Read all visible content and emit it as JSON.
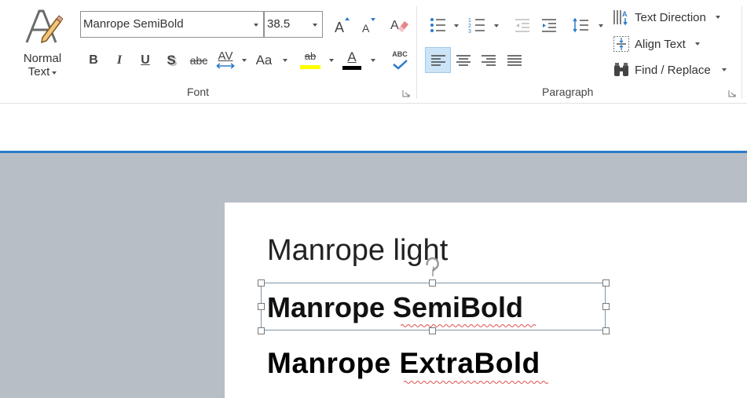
{
  "ribbon": {
    "style": {
      "label_line1": "Normal",
      "label_line2": "Text"
    },
    "font": {
      "family_value": "Manrope SemiBold",
      "size_value": "38.5",
      "group_label": "Font",
      "bold": "B",
      "italic": "I",
      "underline": "U",
      "shadow": "S",
      "strike": "abc",
      "spacing": "AV",
      "case": "Aa",
      "highlight_letters": "ab",
      "font_color_letter": "A",
      "spell": "ABC",
      "highlight_color": "#ffff00",
      "font_color": "#000000"
    },
    "paragraph": {
      "group_label": "Paragraph",
      "text_direction": "Text Direction",
      "align_text": "Align Text",
      "find_replace": "Find / Replace"
    }
  },
  "slide": {
    "line1": "Manrope light",
    "line2": "Manrope SemiBold",
    "line3": "Manrope ExtraBold"
  },
  "colors": {
    "accent": "#2b7bc9",
    "canvas": "#b8bec5",
    "selected_align": "#cce4f7"
  }
}
